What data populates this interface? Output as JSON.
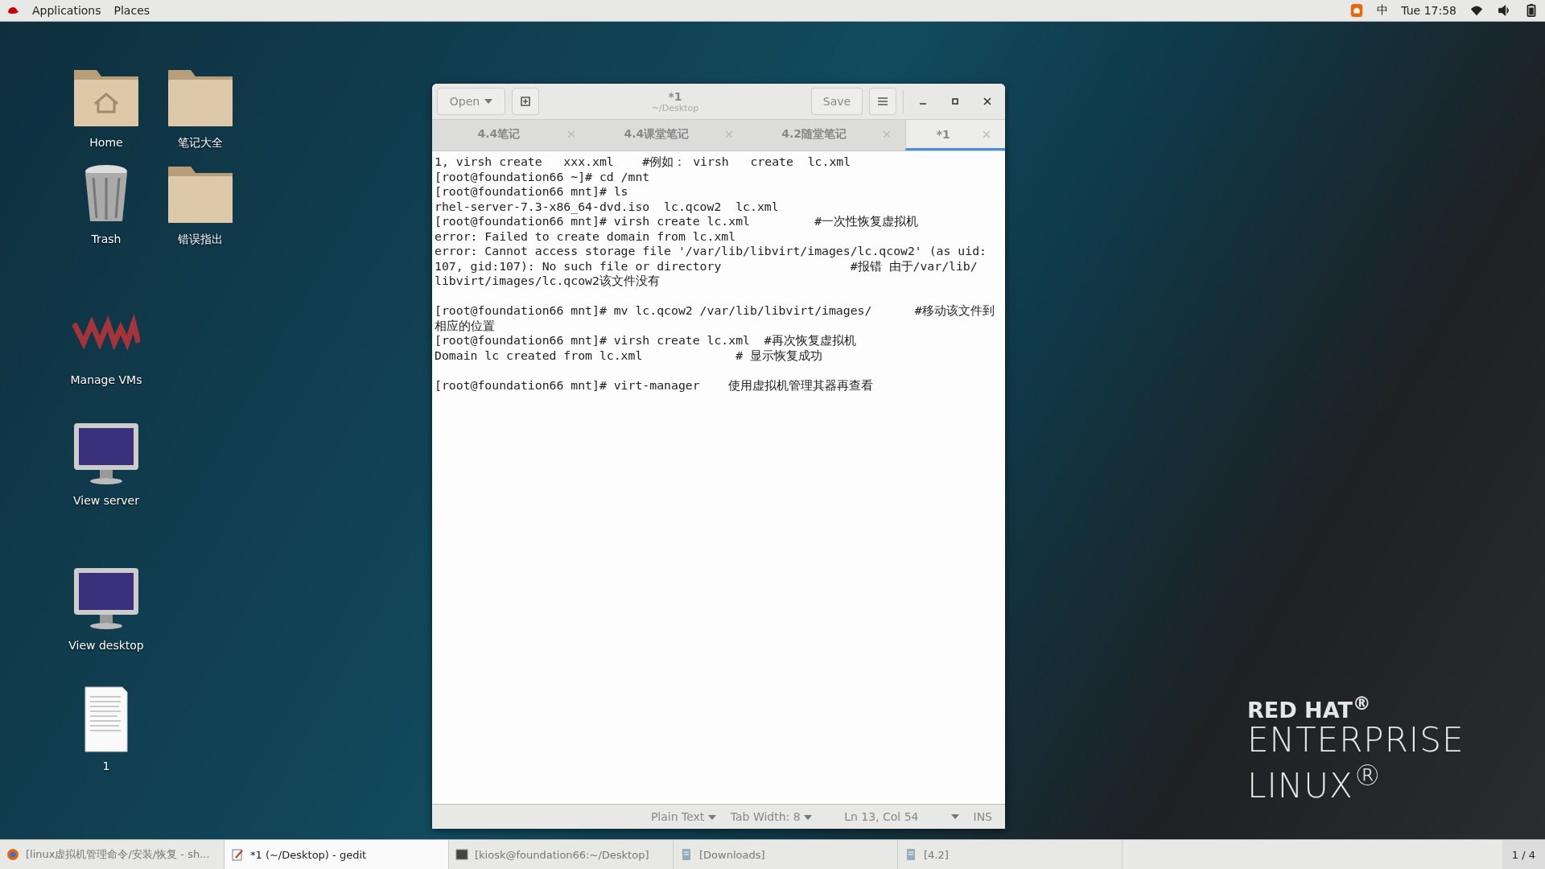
{
  "top_bar": {
    "menus": [
      "Applications",
      "Places"
    ],
    "input_method": "中",
    "clock": "Tue 17:58"
  },
  "desktop_icons": [
    {
      "kind": "home",
      "label": "Home"
    },
    {
      "kind": "folder",
      "label": "笔记大全"
    },
    {
      "kind": "trash",
      "label": "Trash"
    },
    {
      "kind": "folder",
      "label": "错误指出"
    },
    {
      "kind": "vm",
      "label": "Manage VMs"
    },
    {
      "kind": "monitor",
      "label": "View server"
    },
    {
      "kind": "monitor",
      "label": "View desktop"
    },
    {
      "kind": "document",
      "label": "1"
    }
  ],
  "window": {
    "title": "*1",
    "subtitle": "~/Desktop",
    "open_button": "Open",
    "save_button": "Save",
    "tabs": [
      {
        "label": "4.4笔记",
        "selected": false
      },
      {
        "label": "4.4课堂笔记",
        "selected": false
      },
      {
        "label": "4.2随堂笔记",
        "selected": false
      },
      {
        "label": "*1",
        "selected": true
      }
    ],
    "paragraphs": [
      [
        "1, virsh create   xxx.xml    #例如： virsh   create  lc.xml",
        "[root@foundation66 ~]# cd /mnt",
        "[root@foundation66 mnt]# ls",
        "rhel-server-7.3-x86_64-dvd.iso  lc.qcow2  lc.xml",
        "[root@foundation66 mnt]# virsh create lc.xml         #一次性恢复虚拟机",
        "error: Failed to create domain from lc.xml",
        "error: Cannot access storage file '/var/lib/libvirt/images/lc.qcow2' (as uid:",
        "107, gid:107): No such file or directory                  #报错 由于/var/lib/",
        "libvirt/images/lc.qcow2该文件没有"
      ],
      [
        "[root@foundation66 mnt]# mv lc.qcow2 /var/lib/libvirt/images/      #移动该文件到",
        "相应的位置",
        "[root@foundation66 mnt]# virsh create lc.xml  #再次恢复虚拟机",
        "Domain lc created from lc.xml             # 显示恢复成功"
      ],
      [
        "[root@foundation66 mnt]# virt-manager    使用虚拟机管理其器再查看"
      ]
    ],
    "status_bar": {
      "language": "Plain Text",
      "tab_width": "Tab Width: 8",
      "position": "Ln 13, Col 54",
      "mode": "INS"
    }
  },
  "branding": {
    "line_1": "RED HAT$^{®}$",
    "line_2": "ENTERPRISE",
    "line_3": "LINUX$^{®}$"
  },
  "taskbar": {
    "items": [
      {
        "kind": "browser",
        "label": "[linux虚拟机管理命令/安装/恢复 - sh...",
        "selected": false
      },
      {
        "kind": "editor",
        "label": "*1 (~/Desktop) - gedit",
        "selected": true
      },
      {
        "kind": "terminal",
        "label": "[kiosk@foundation66:~/Desktop]",
        "selected": false
      },
      {
        "kind": "files",
        "label": "[Downloads]",
        "selected": false
      },
      {
        "kind": "files",
        "label": "[4.2]",
        "selected": false
      }
    ],
    "workspace": "1 / 4"
  }
}
